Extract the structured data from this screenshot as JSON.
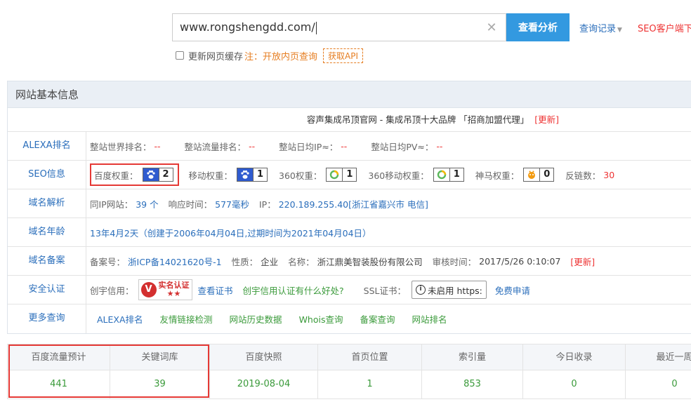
{
  "search": {
    "value": "www.rongshengdd.com/",
    "button": "查看分析",
    "history": "查询记录",
    "seo_client": "SEO客户端下",
    "cache_label": "更新网页缓存",
    "cache_note": "注：开放内页查询",
    "api_button": "获取API"
  },
  "panel": {
    "title": "网站基本信息",
    "promo_text": "容声集成吊顶官网 - 集成吊顶十大品牌 「招商加盟代理」",
    "promo_update": "[更新]",
    "alexa": {
      "label": "ALEXA排名",
      "world_label": "整站世界排名：",
      "world_value": "--",
      "traffic_label": "整站流量排名：",
      "traffic_value": "--",
      "ip_label": "整站日均IP≈：",
      "ip_value": "--",
      "pv_label": "整站日均PV≈：",
      "pv_value": "--"
    },
    "seo": {
      "label": "SEO信息",
      "baidu_label": "百度权重：",
      "baidu_value": "2",
      "mobile_label": "移动权重：",
      "mobile_value": "1",
      "s360_label": "360权重：",
      "s360_value": "1",
      "s360m_label": "360移动权重：",
      "s360m_value": "1",
      "shenma_label": "神马权重：",
      "shenma_value": "0",
      "backlinks_label": "反链数：",
      "backlinks_value": "30"
    },
    "domain": {
      "label": "域名解析",
      "sameip_label": "同IP网站：",
      "sameip_value": "39 个",
      "response_label": "响应时间：",
      "response_value": "577毫秒",
      "ip_label": "IP：",
      "ip_value": "220.189.255.40[浙江省嘉兴市 电信]"
    },
    "age": {
      "label": "域名年龄",
      "value": "13年4月2天（创建于2006年04月04日,过期时间为2021年04月04日）"
    },
    "icp": {
      "label": "域名备案",
      "no_label": "备案号：",
      "no_value": "浙ICP备14021620号-1",
      "type_label": "性质：",
      "type_value": "企业",
      "name_label": "名称：",
      "name_value": "浙江鼎美智装股份有限公司",
      "audit_label": "审核时间：",
      "audit_value": "2017/5/26 0:10:07",
      "update": "[更新]"
    },
    "security": {
      "label": "安全认证",
      "credit_label": "创宇信用：",
      "badge_text": "实名认证",
      "badge_stars": "★★",
      "view_cert": "查看证书",
      "credit_benefit": "创宇信用认证有什么好处?",
      "ssl_label": "SSL证书：",
      "ssl_value": "未启用 https:",
      "free_apply": "免费申请"
    },
    "more": {
      "label": "更多查询",
      "links": [
        "ALEXA排名",
        "友情链接检测",
        "网站历史数据",
        "Whois查询",
        "备案查询",
        "网站排名"
      ]
    }
  },
  "stats": {
    "headers": [
      "百度流量预计",
      "关键词库",
      "百度快照",
      "首页位置",
      "索引量",
      "今日收录",
      "最近一周"
    ],
    "values": [
      "441",
      "39",
      "2019-08-04",
      "1",
      "853",
      "0",
      "0"
    ]
  },
  "colors": {
    "accent": "#3399e0",
    "link": "#2a6ebb",
    "red": "#e33",
    "green": "#3a9a3a",
    "highlight": "#e53935"
  }
}
